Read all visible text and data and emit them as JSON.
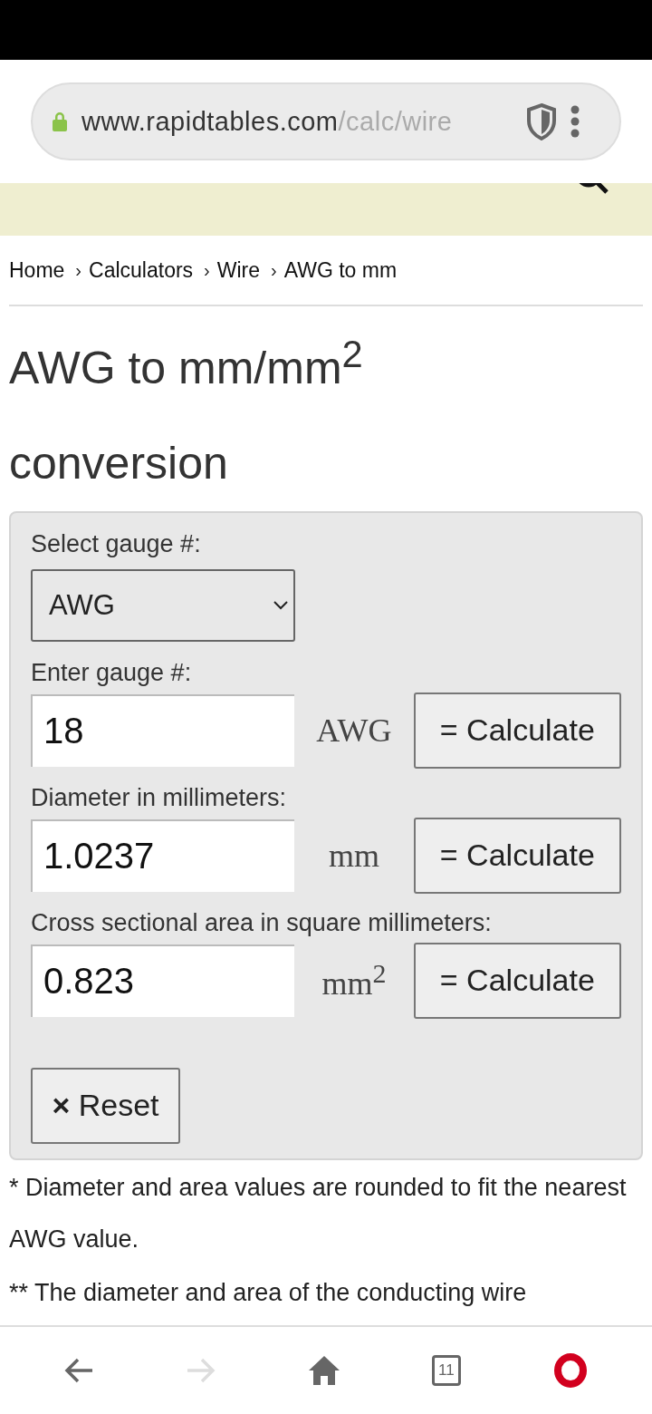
{
  "browser": {
    "url_host": "www.rapidtables.com",
    "url_path": "/calc/wire"
  },
  "site_header": {
    "show": true
  },
  "breadcrumb": {
    "separator": "›",
    "items": [
      "Home",
      "Calculators",
      "Wire",
      "AWG to mm"
    ]
  },
  "title": "AWG to mm/mm$^{2}$ conversion",
  "form": {
    "select_label": "Select gauge #:",
    "select_value": "AWG",
    "rows": [
      {
        "label": "Enter gauge #:",
        "value": "18",
        "unit": "AWG",
        "button": "= Calculate"
      },
      {
        "label": "Diameter in millimeters:",
        "value": "1.0237",
        "unit": "mm",
        "button": "= Calculate"
      },
      {
        "label": "Cross sectional area in square millimeters:",
        "value": "0.823",
        "unit": "mm$^{2}$",
        "button": "= Calculate"
      }
    ],
    "reset_icon": "×",
    "reset": "Reset"
  },
  "notes": [
    "* Diameter and area values are rounded to fit the nearest AWG value.",
    "** The diameter and area of the conducting wire"
  ],
  "nav": {
    "tab_count": "11",
    "forward_disabled": true
  }
}
